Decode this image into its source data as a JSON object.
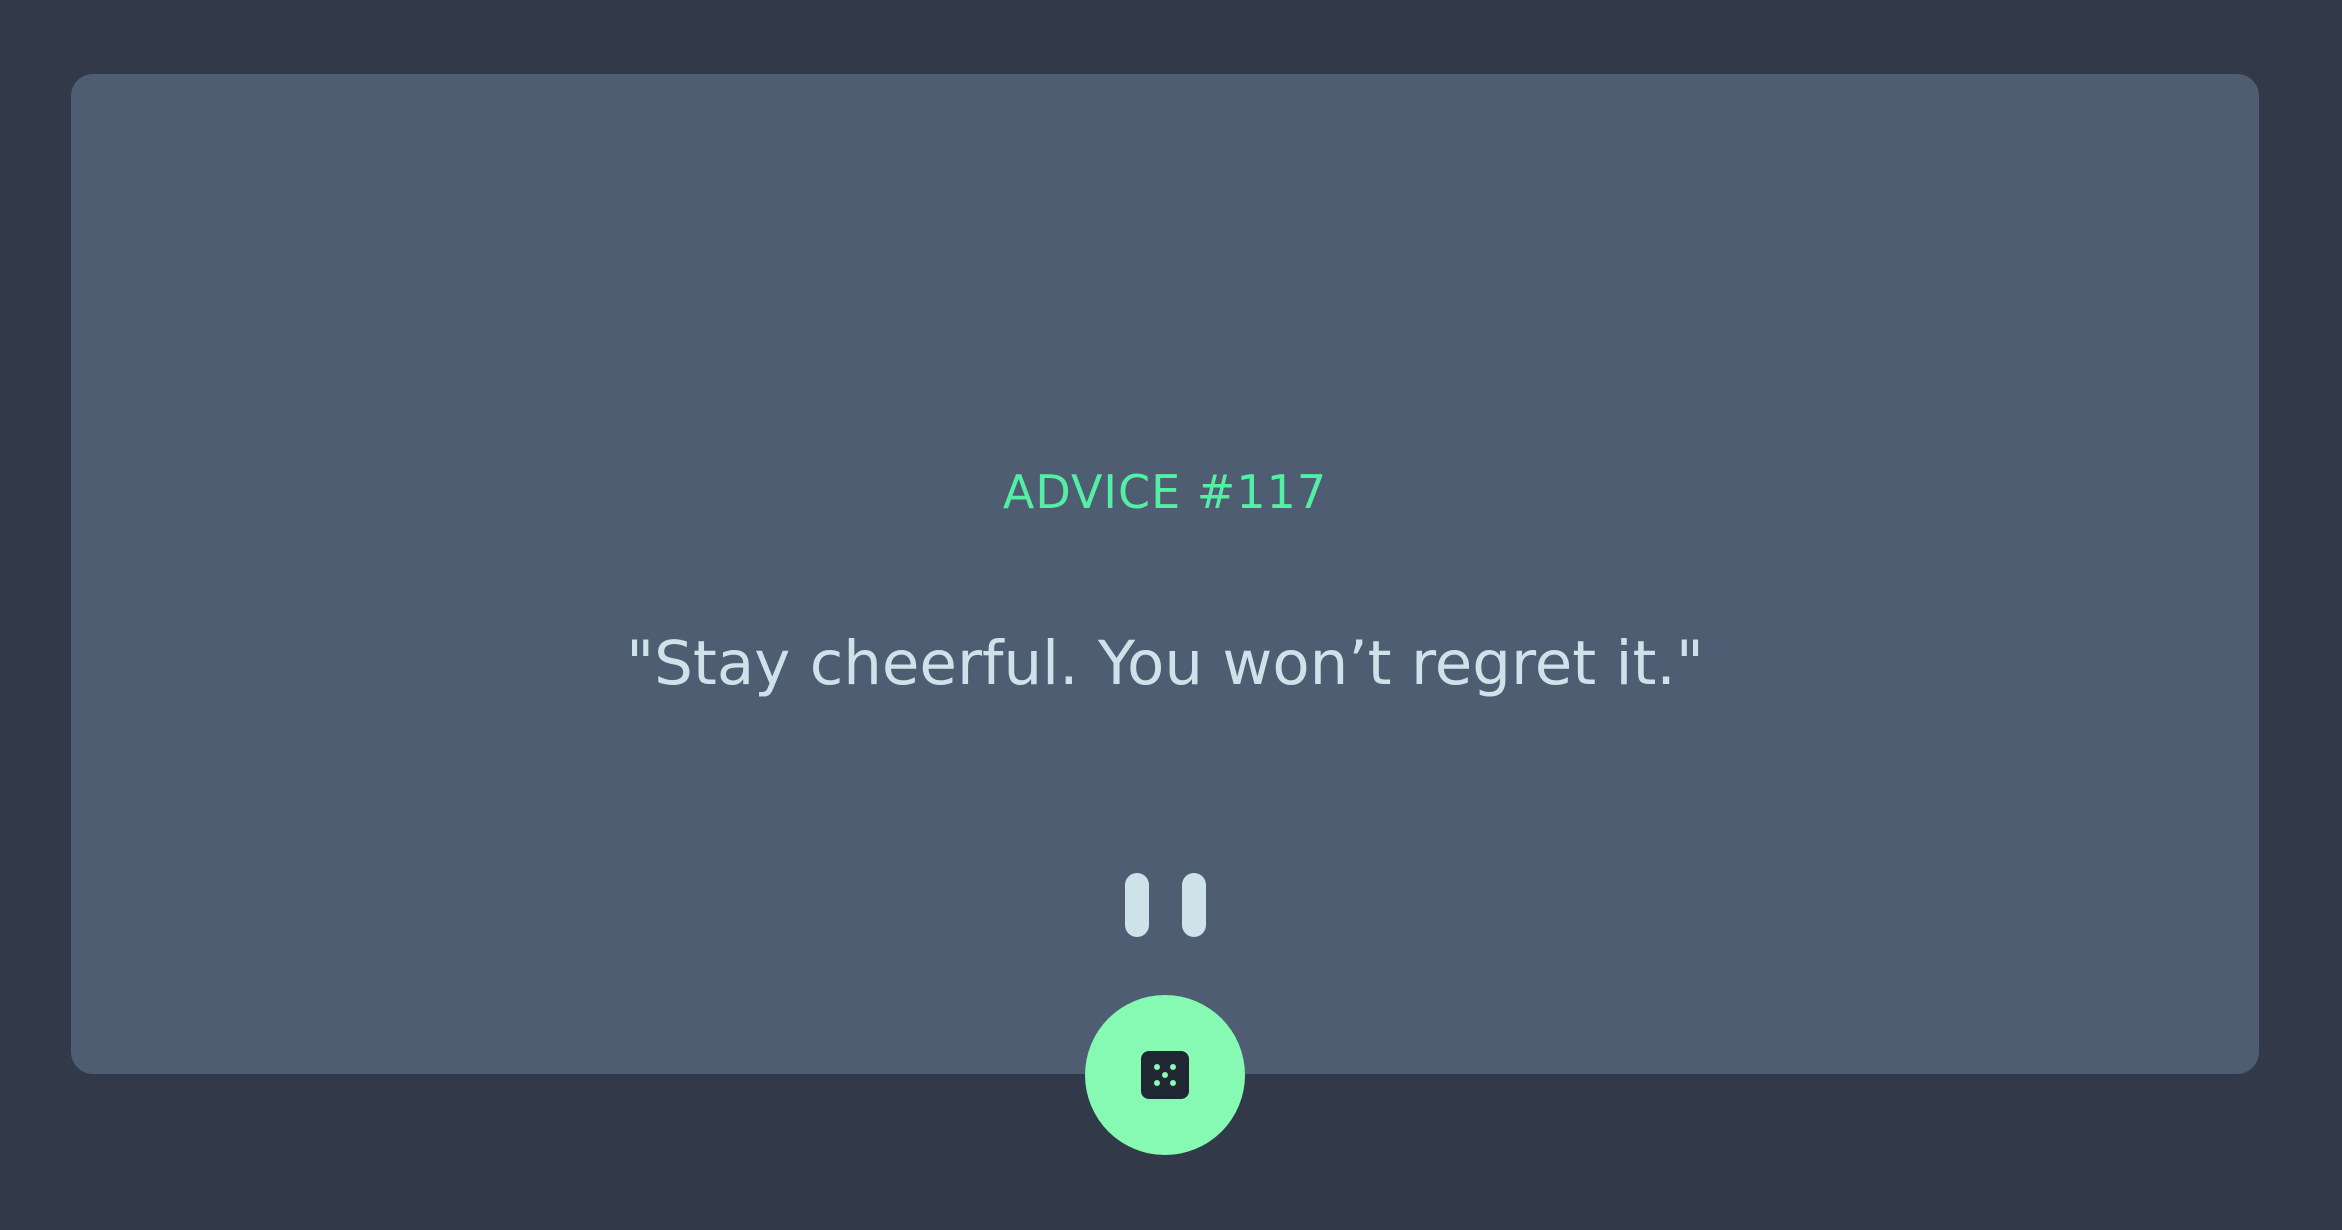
{
  "advice": {
    "id_label": "ADVICE #117",
    "quote": "\"Stay cheerful. You won’t regret it.\""
  },
  "icons": {
    "divider": "pause-icon",
    "button": "dice-icon"
  },
  "colors": {
    "background": "#323a49",
    "card": "#4f5d73",
    "accent": "#53ffaa",
    "button": "#86f9b2",
    "text": "#cee3e9"
  }
}
